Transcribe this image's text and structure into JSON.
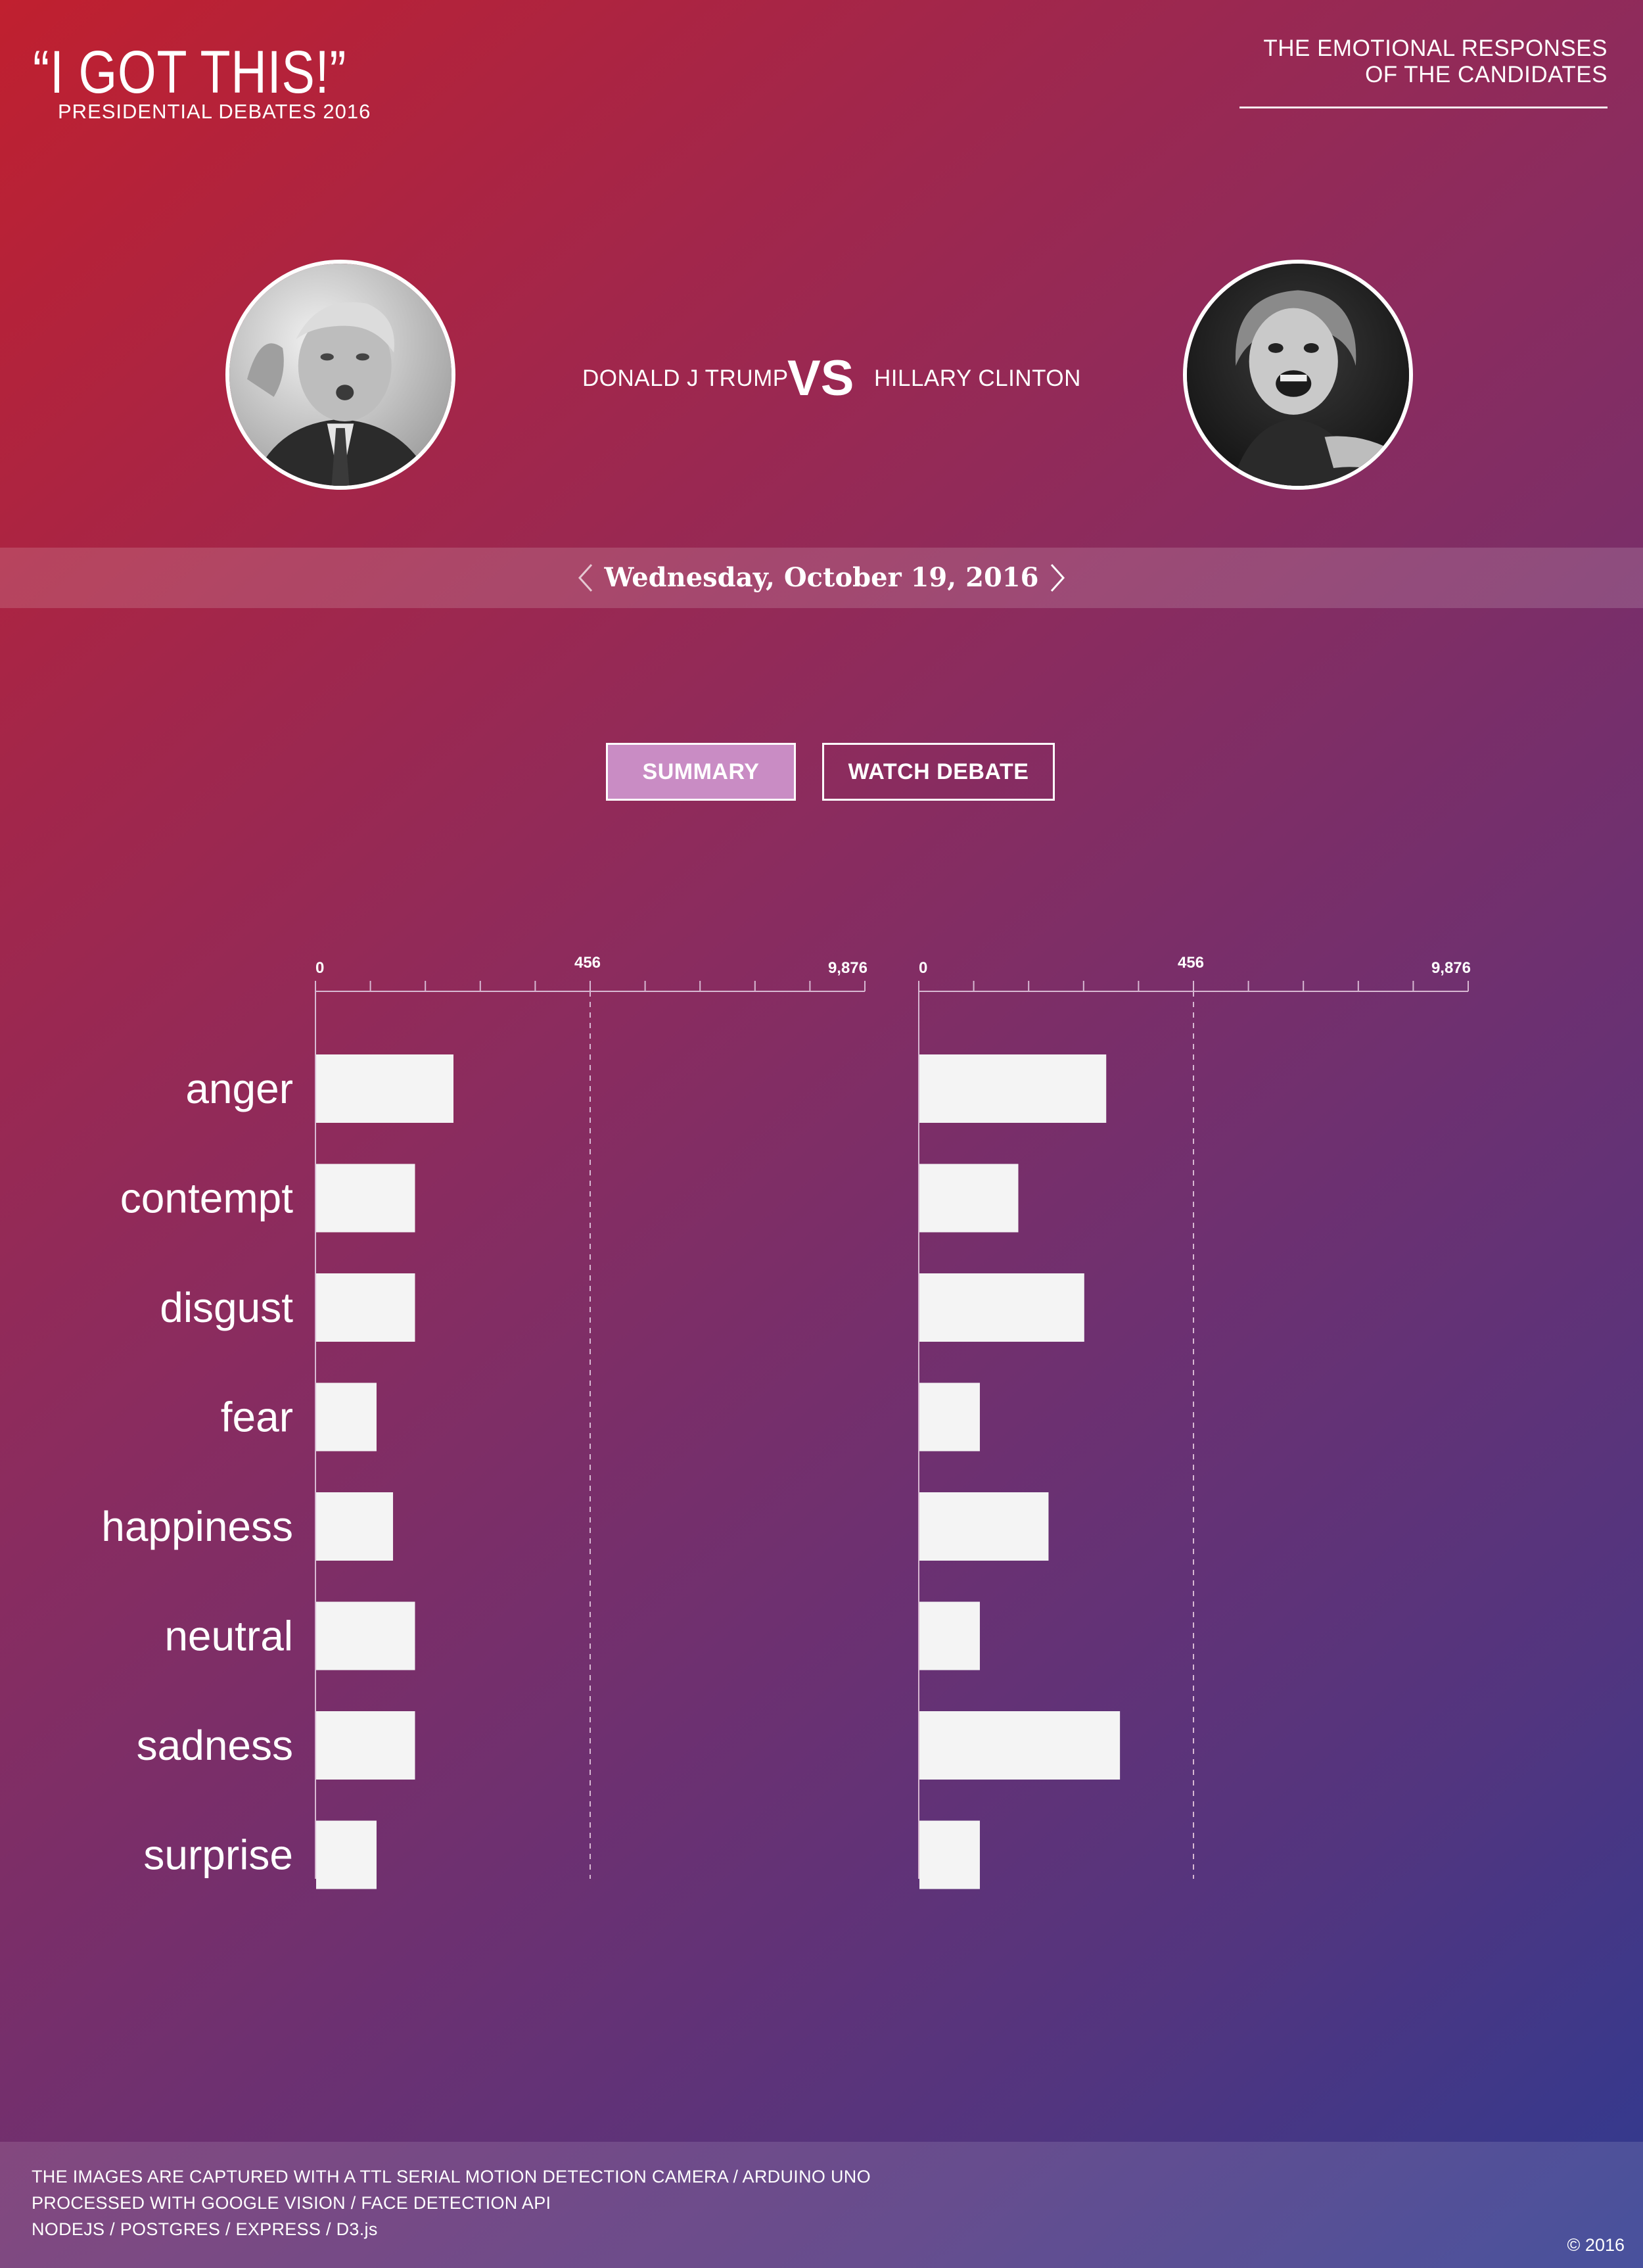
{
  "header": {
    "title": "“I GOT THIS!”",
    "subtitle": "PRESIDENTIAL DEBATES 2016",
    "right_line1": "THE EMOTIONAL RESPONSES",
    "right_line2": "OF THE CANDIDATES"
  },
  "candidates": {
    "left_name": "DONALD J TRUMP",
    "vs": "VS",
    "right_name": "HILLARY CLINTON"
  },
  "date_nav": {
    "date": "Wednesday, October 19, 2016"
  },
  "tabs": {
    "summary": "SUMMARY",
    "watch": "WATCH DEBATE"
  },
  "chart_data": {
    "type": "bar",
    "orientation": "horizontal",
    "categories": [
      "anger",
      "contempt",
      "disgust",
      "fear",
      "happiness",
      "neutral",
      "sadness",
      "surprise"
    ],
    "axis": {
      "tick_labels": [
        "0",
        "456",
        "9,876"
      ],
      "minor_ticks": 10,
      "reference_line_label": "456"
    },
    "series": [
      {
        "values": [
          2.5,
          1.8,
          1.8,
          1.1,
          1.4,
          1.8,
          1.8,
          1.1
        ]
      },
      {
        "values": [
          3.4,
          1.8,
          3.0,
          1.1,
          2.35,
          1.1,
          3.65,
          1.1
        ]
      }
    ],
    "xlim": [
      0,
      10
    ],
    "grid": false,
    "colors": {
      "bar": "#f4f4f4",
      "axis": "#d7b8d2"
    }
  },
  "footer": {
    "line1": "THE IMAGES ARE CAPTURED WITH A TTL SERIAL MOTION DETECTION CAMERA / ARDUINO UNO",
    "line2": "PROCESSED WITH GOOGLE VISION / FACE DETECTION API",
    "line3": "NODEJS / POSTGRES / EXPRESS / D3.js",
    "copyright": "© 2016"
  }
}
